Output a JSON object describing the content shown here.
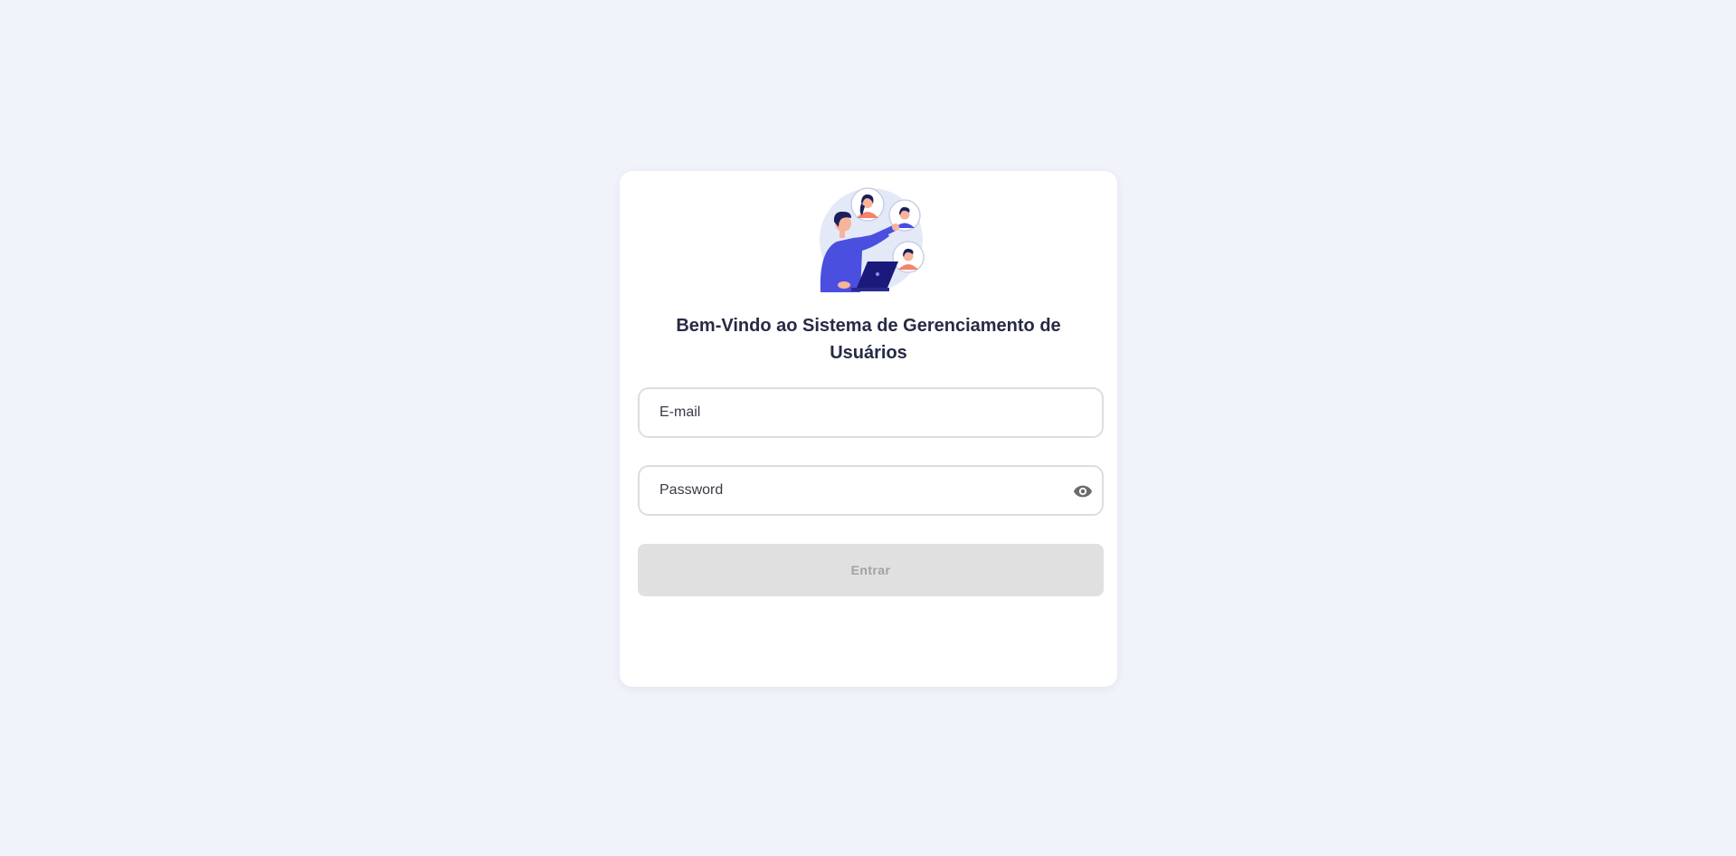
{
  "login": {
    "title": "Bem-Vindo ao Sistema de Gerenciamento de Usuários",
    "email": {
      "placeholder": "E-mail",
      "value": ""
    },
    "password": {
      "placeholder": "Password",
      "value": "",
      "toggle_icon": "eye-icon"
    },
    "submit_label": "Entrar",
    "illustration": "team-management-illustration"
  },
  "colors": {
    "background": "#f0f3fa",
    "card": "#ffffff",
    "title": "#262a45",
    "input_border": "#dcdde3",
    "button_disabled_bg": "#e0e0e0",
    "button_disabled_text": "#a2a2a2",
    "accent": "#4a4fe0"
  }
}
